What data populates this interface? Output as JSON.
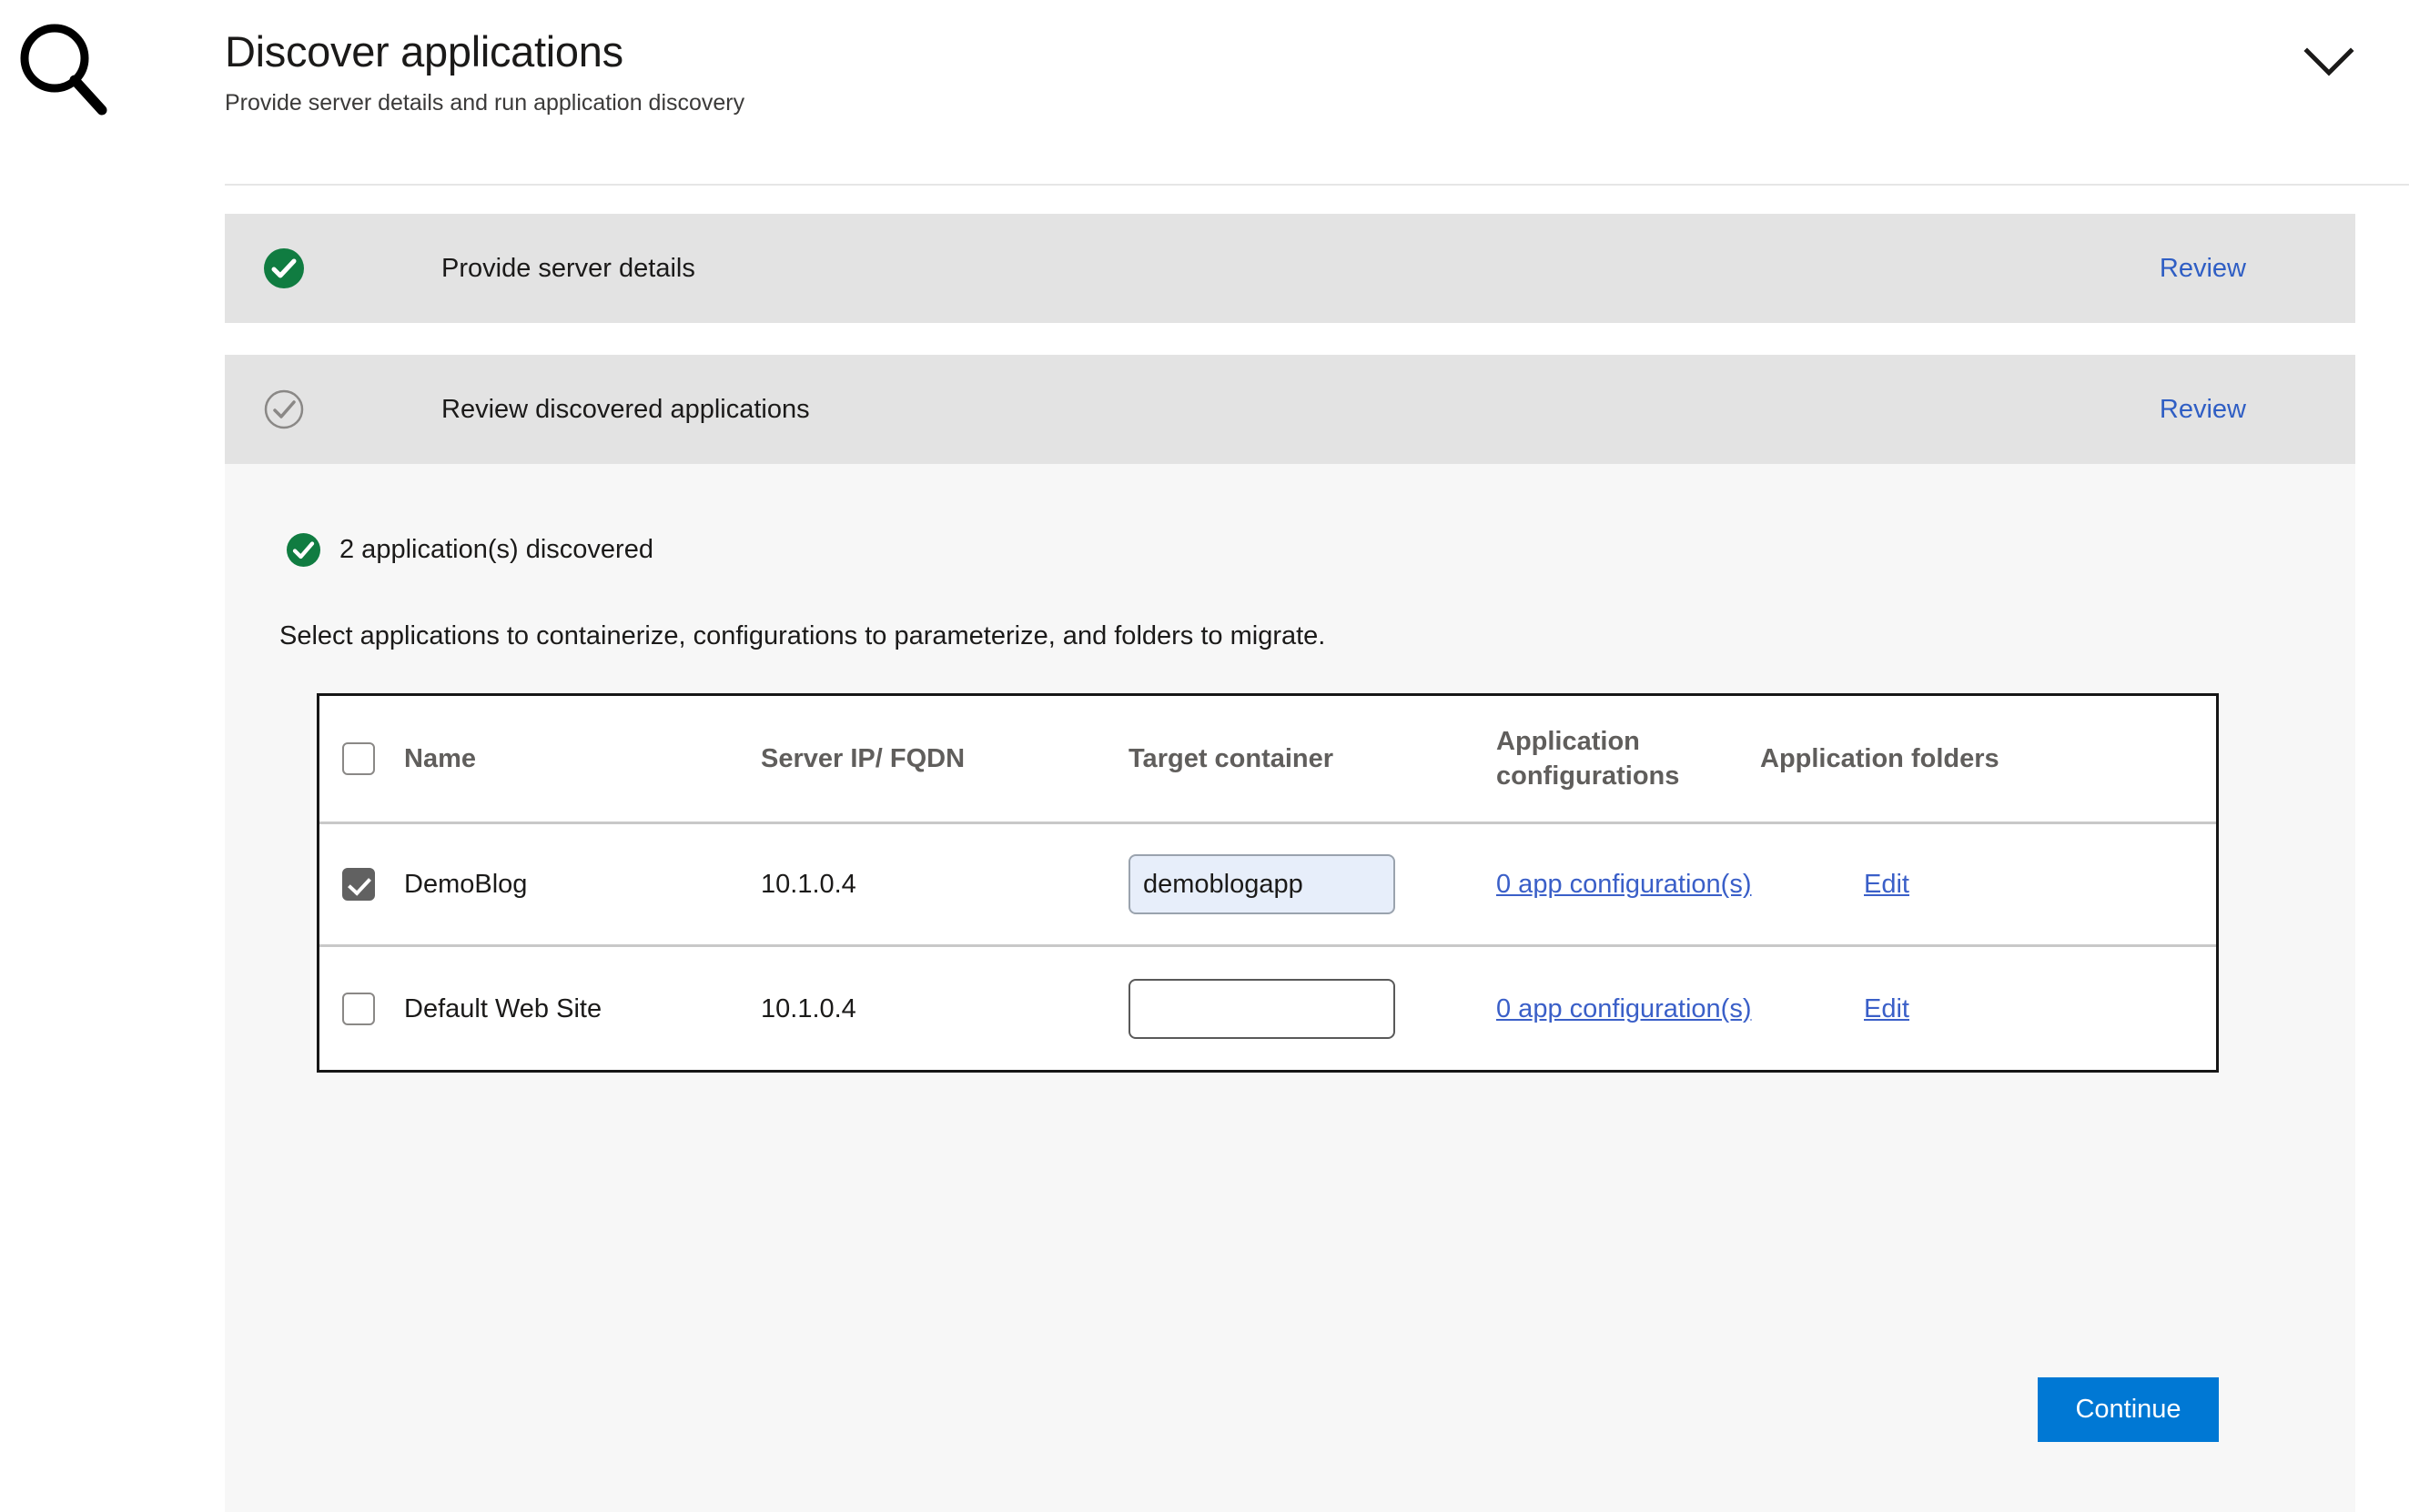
{
  "header": {
    "icon": "magnifying-glass-icon",
    "title": "Discover applications",
    "subtitle": "Provide server details and run application discovery",
    "collapse_icon": "chevron-down-icon"
  },
  "wizard": {
    "steps": [
      {
        "status_icon": "check-circle-filled-icon",
        "label": "Provide server details",
        "action_label": "Review"
      },
      {
        "status_icon": "check-circle-outline-icon",
        "label": "Review discovered applications",
        "action_label": "Review"
      }
    ]
  },
  "discovery": {
    "status_icon": "check-circle-filled-icon",
    "status_text": "2 application(s) discovered",
    "instruction": "Select applications to containerize, configurations to parameterize, and folders to migrate."
  },
  "table": {
    "select_all_checked": false,
    "columns": [
      "Name",
      "Server IP/ FQDN",
      "Target container",
      "Application configurations",
      "Application folders"
    ],
    "rows": [
      {
        "selected": true,
        "name": "DemoBlog",
        "server": "10.1.0.4",
        "target_container": "demoblogapp",
        "target_container_placeholder": "",
        "app_configurations_link": "0 app configuration(s)",
        "app_folders_link": "Edit"
      },
      {
        "selected": false,
        "name": "Default Web Site",
        "server": "10.1.0.4",
        "target_container": "",
        "target_container_placeholder": "",
        "app_configurations_link": "0 app configuration(s)",
        "app_folders_link": "Edit"
      }
    ]
  },
  "footer": {
    "continue_label": "Continue"
  },
  "colors": {
    "accent": "#0078d4",
    "success": "#107c41",
    "link": "#3a5fc8",
    "step_bar": "#e3e3e3",
    "content_bg": "#f7f7f7"
  }
}
